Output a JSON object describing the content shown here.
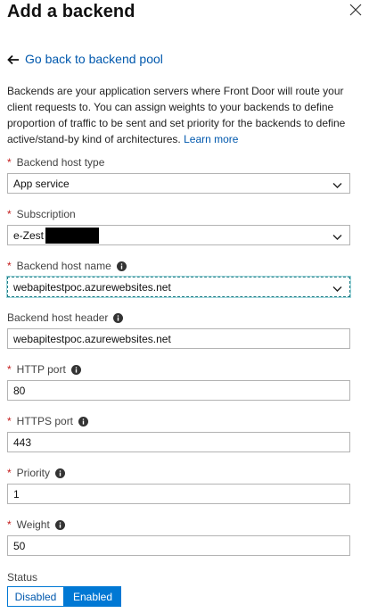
{
  "header": {
    "title": "Add a backend"
  },
  "back_link": {
    "label": "Go back to backend pool"
  },
  "description": {
    "text": "Backends are your application servers where Front Door will route your client requests to. You can assign weights to your backends to define proportion of traffic to be sent and set priority for the backends to define active/stand-by kind of architectures.",
    "link": "Learn more"
  },
  "fields": {
    "backend_host_type": {
      "label": "Backend host type",
      "value": "App service"
    },
    "subscription": {
      "label": "Subscription",
      "value": "e-Zest"
    },
    "backend_host_name": {
      "label": "Backend host name",
      "value": "webapitestpoc.azurewebsites.net"
    },
    "backend_host_header": {
      "label": "Backend host header",
      "value": "webapitestpoc.azurewebsites.net"
    },
    "http_port": {
      "label": "HTTP port",
      "value": "80"
    },
    "https_port": {
      "label": "HTTPS port",
      "value": "443"
    },
    "priority": {
      "label": "Priority",
      "value": "1"
    },
    "weight": {
      "label": "Weight",
      "value": "50"
    }
  },
  "status": {
    "label": "Status",
    "options": [
      "Disabled",
      "Enabled"
    ],
    "selected": "Enabled"
  },
  "icons": {
    "close": "close-icon",
    "back": "arrow-left-icon",
    "info": "info-icon",
    "chevron": "chevron-down-icon"
  },
  "colors": {
    "link": "#0058ad",
    "accent": "#0078d4",
    "required": "#c41c1c"
  }
}
